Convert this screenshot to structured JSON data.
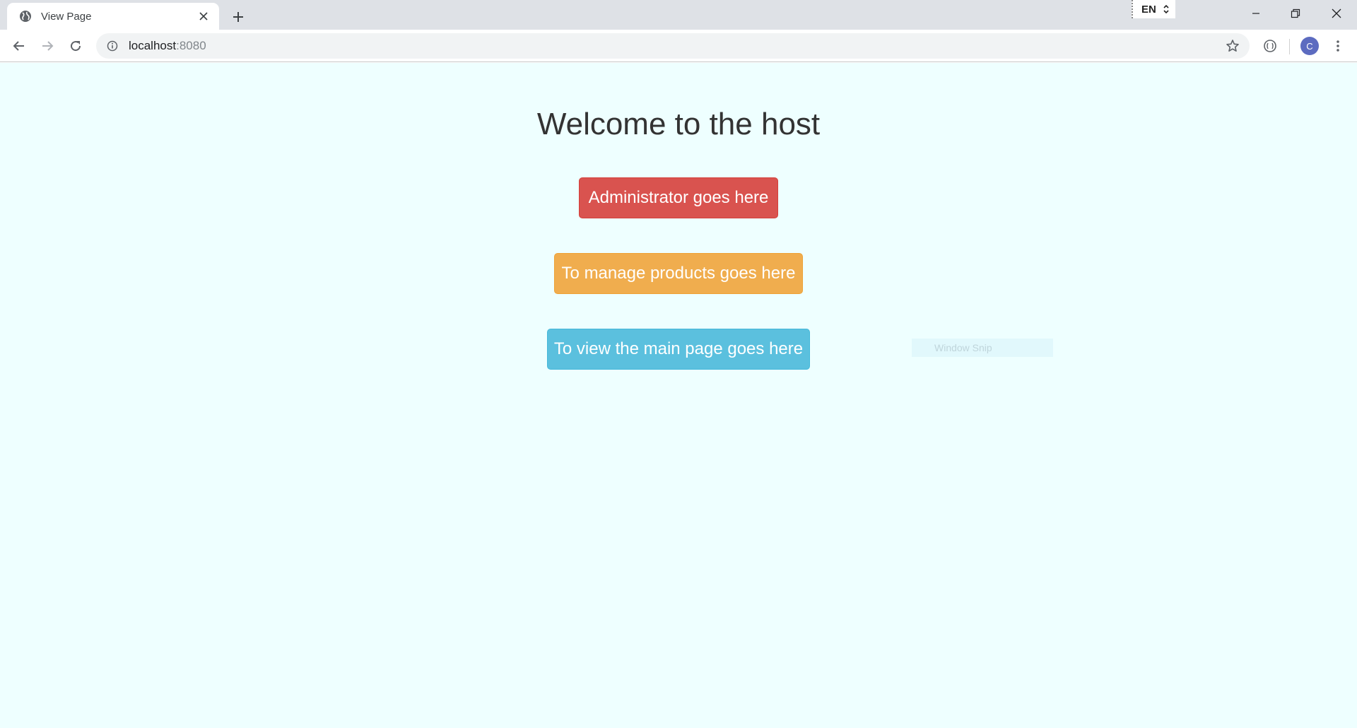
{
  "browser": {
    "tab": {
      "title": "View Page",
      "favicon": "globe-icon"
    },
    "new_tab_icon": "plus-icon",
    "language": "EN",
    "window_controls": [
      "minimize-icon",
      "restore-icon",
      "close-icon"
    ],
    "address_bar": {
      "host": "localhost",
      "port": ":8080",
      "security_icon": "info-icon"
    },
    "profile_initial": "C"
  },
  "page": {
    "background": "#eeffff",
    "title": "Welcome to the host",
    "buttons": [
      {
        "label": "Administrator goes here",
        "color": "#d9534f"
      },
      {
        "label": "To manage products goes here",
        "color": "#f0ad4e"
      },
      {
        "label": "To view the main page goes here",
        "color": "#5bc0de"
      }
    ]
  },
  "overlay": {
    "snip_label": "Window Snip"
  }
}
